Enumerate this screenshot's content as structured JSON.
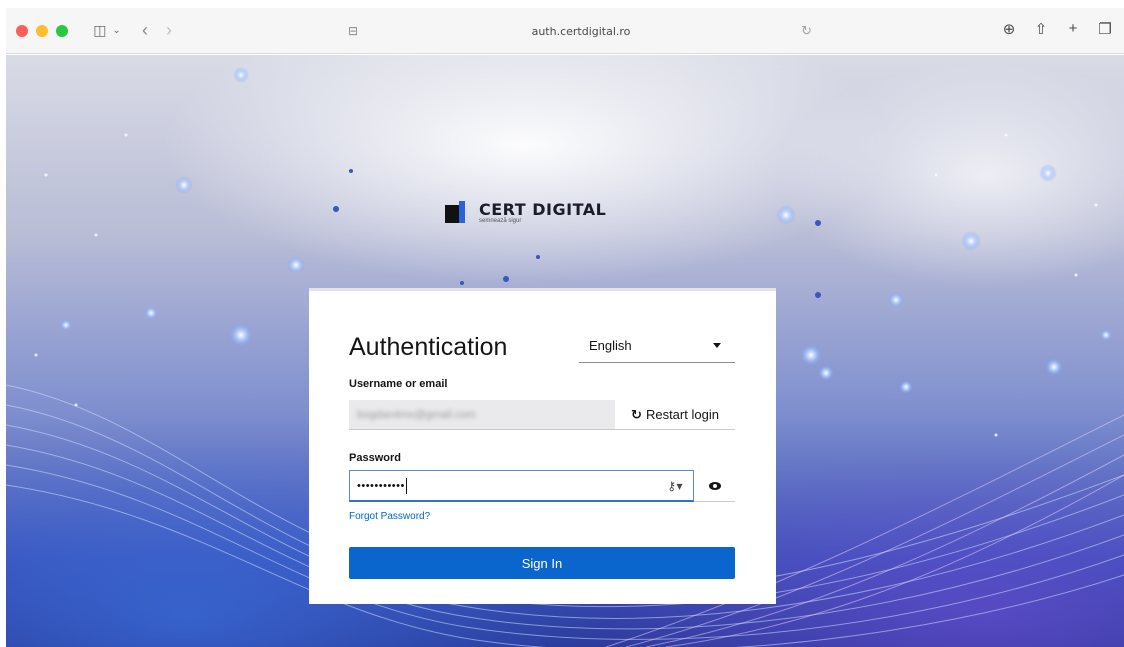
{
  "browser": {
    "url": "auth.certdigital.ro",
    "nav_back": "‹",
    "nav_forward": "›",
    "sidebar_icon": "sidebar-icon",
    "tools": [
      "download-icon",
      "share-icon",
      "new-tab-icon",
      "tabs-overview-icon"
    ]
  },
  "logo": {
    "name": "CERT DIGITAL",
    "tagline": "semnează sigur",
    "brand_color": "#2b63d6"
  },
  "login": {
    "title": "Authentication",
    "language": "English",
    "username_label": "Username or email",
    "username_value": "bogdan4mx@gmail.com",
    "restart_label": "Restart login",
    "password_label": "Password",
    "password_value": "•••••••••••",
    "forgot_label": "Forgot Password?",
    "signin_label": "Sign In",
    "primary_color": "#0a66cc"
  }
}
